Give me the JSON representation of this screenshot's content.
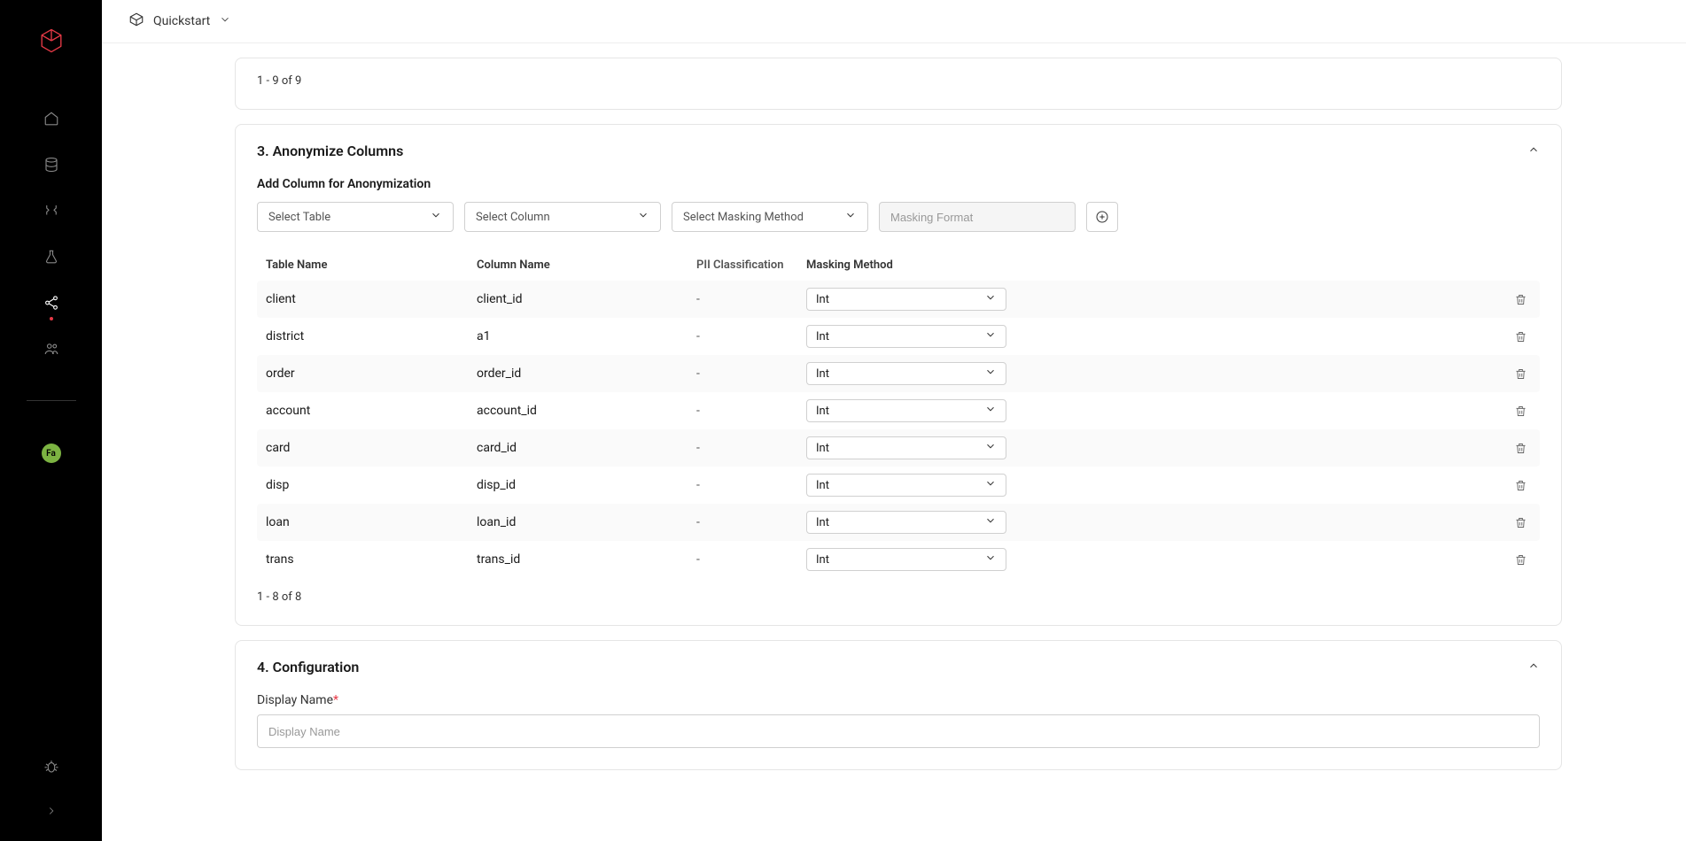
{
  "topbar": {
    "title": "Quickstart"
  },
  "avatar_initials": "Fa",
  "card1": {
    "pagination": "1 - 9 of 9"
  },
  "section3": {
    "title": "3. Anonymize Columns",
    "add_label": "Add Column for Anonymization",
    "select_table_ph": "Select Table",
    "select_column_ph": "Select Column",
    "select_method_ph": "Select Masking Method",
    "format_ph": "Masking Format",
    "headers": {
      "table": "Table Name",
      "column": "Column Name",
      "pii": "PII Classification",
      "method": "Masking Method"
    },
    "rows": [
      {
        "table": "client",
        "column": "client_id",
        "pii": "-",
        "method": "Int"
      },
      {
        "table": "district",
        "column": "a1",
        "pii": "-",
        "method": "Int"
      },
      {
        "table": "order",
        "column": "order_id",
        "pii": "-",
        "method": "Int"
      },
      {
        "table": "account",
        "column": "account_id",
        "pii": "-",
        "method": "Int"
      },
      {
        "table": "card",
        "column": "card_id",
        "pii": "-",
        "method": "Int"
      },
      {
        "table": "disp",
        "column": "disp_id",
        "pii": "-",
        "method": "Int"
      },
      {
        "table": "loan",
        "column": "loan_id",
        "pii": "-",
        "method": "Int"
      },
      {
        "table": "trans",
        "column": "trans_id",
        "pii": "-",
        "method": "Int"
      }
    ],
    "pagination": "1 - 8 of 8"
  },
  "section4": {
    "title": "4. Configuration",
    "display_name_label": "Display Name",
    "display_name_ph": "Display Name"
  }
}
